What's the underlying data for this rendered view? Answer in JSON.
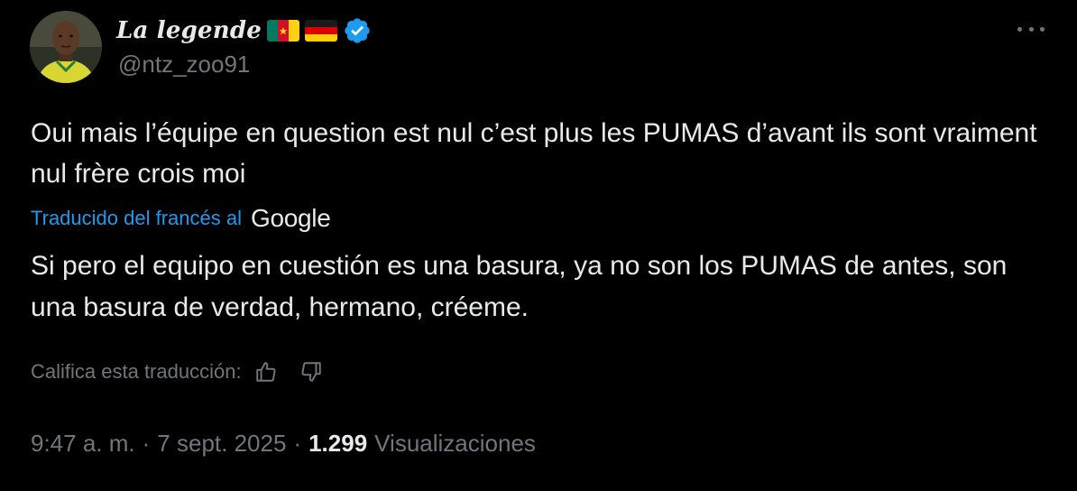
{
  "author": {
    "display_name": "La legende",
    "handle": "@ntz_zoo91",
    "flags": [
      "cameroon-flag",
      "germany-flag"
    ],
    "verified": true
  },
  "tweet": {
    "original_text": "Oui mais l’équipe en question est nul c’est plus les PUMAS d’avant ils sont vraiment nul frère crois moi",
    "translated_from": "Traducido del francés al",
    "translator_brand": "Google",
    "translation_text": "Si pero el equipo en cuestión es una basura, ya no son los PUMAS de antes, son una basura de verdad, hermano, créeme.",
    "rate_label": "Califica esta traducción:",
    "time": "9:47 a. m.",
    "date": "7 sept. 2025",
    "separator": "·",
    "views_count": "1.299",
    "views_label": "Visualizaciones"
  },
  "icons": {
    "more": "more-horizontal-icon",
    "verified": "verified-badge-icon",
    "thumbs_up": "thumbs-up-icon",
    "thumbs_down": "thumbs-down-icon"
  },
  "colors": {
    "background": "#000000",
    "text": "#e7e9ea",
    "secondary": "#71767b",
    "link": "#1d9bf0"
  }
}
